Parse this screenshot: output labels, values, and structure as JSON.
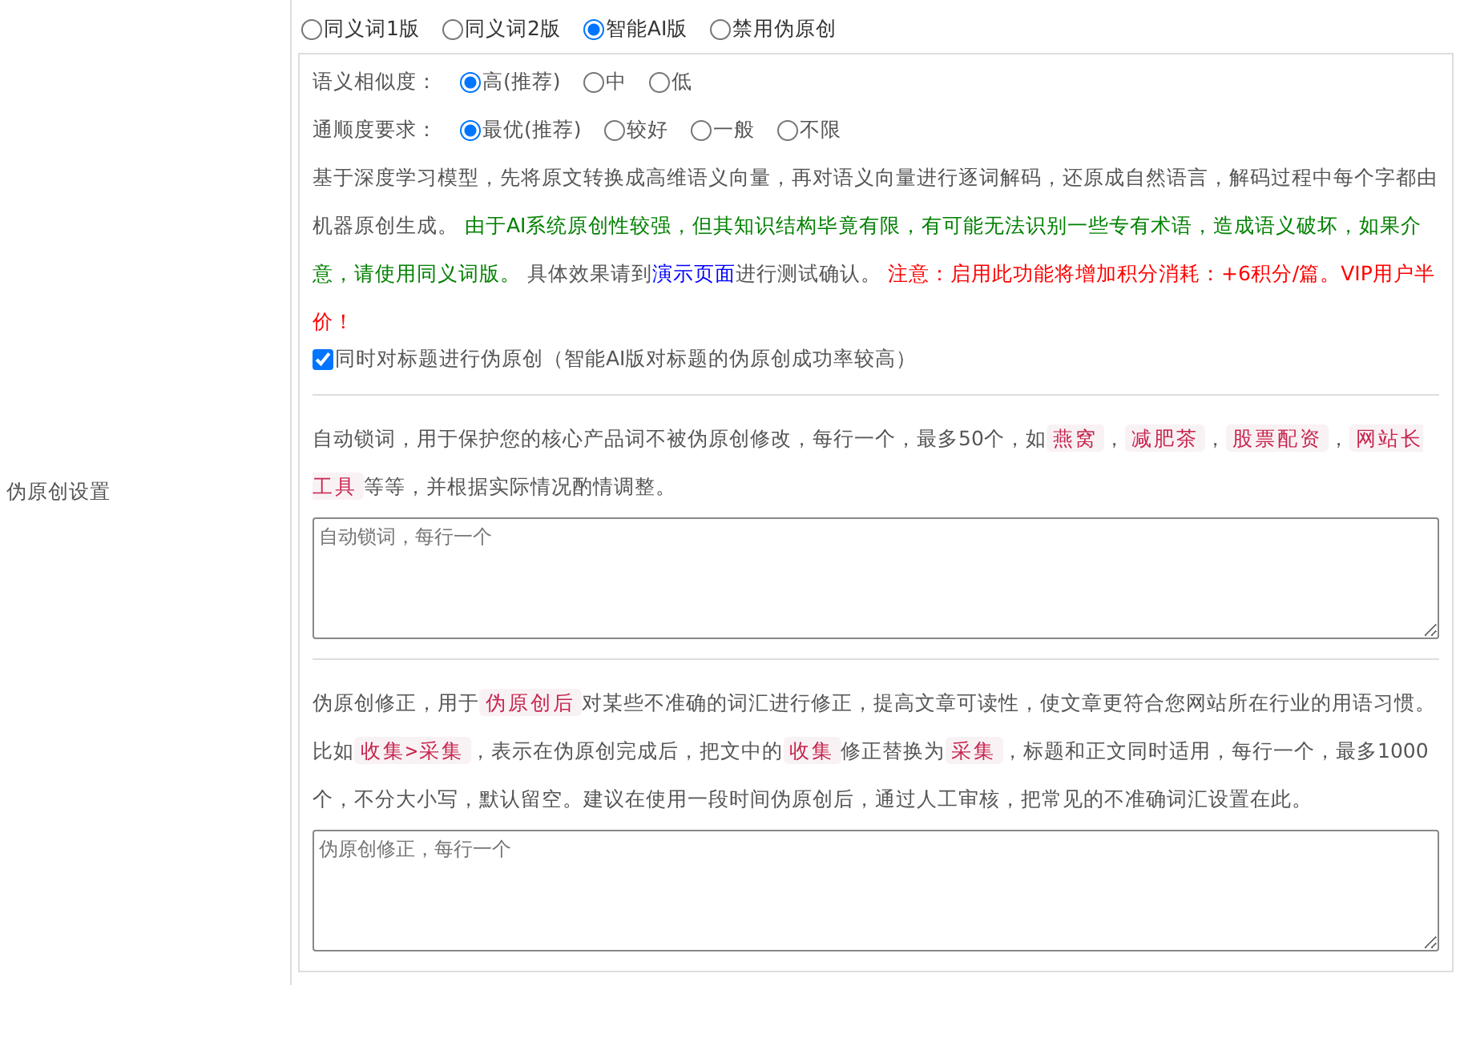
{
  "side_label": "伪原创设置",
  "modes": [
    {
      "label": "同义词1版",
      "selected": false
    },
    {
      "label": "同义词2版",
      "selected": false
    },
    {
      "label": "智能AI版",
      "selected": true
    },
    {
      "label": "禁用伪原创",
      "selected": false
    }
  ],
  "ai_options": {
    "similarity": {
      "label": "语义相似度：",
      "options": [
        {
          "label": "高(推荐)",
          "selected": true
        },
        {
          "label": "中",
          "selected": false
        },
        {
          "label": "低",
          "selected": false
        }
      ]
    },
    "fluency": {
      "label": "通顺度要求：",
      "options": [
        {
          "label": "最优(推荐)",
          "selected": true
        },
        {
          "label": "较好",
          "selected": false
        },
        {
          "label": "一般",
          "selected": false
        },
        {
          "label": "不限",
          "selected": false
        }
      ]
    },
    "description": [
      {
        "kind": "text",
        "text": "基于深度学习模型，先将原文转换成高维语义向量，再对语义向量进行逐词解码，还原成自然语言，解码过程中每个字都由机器原创生成。 "
      },
      {
        "kind": "notice",
        "text": "由于AI系统原创性较强，但其知识结构毕竟有限，有可能无法识别一些专有术语，造成语义破坏，如果介意，请使用同义词版。"
      },
      {
        "kind": "text",
        "text": " 具体效果请到"
      },
      {
        "kind": "link",
        "text": "演示页面"
      },
      {
        "kind": "text",
        "text": "进行测试确认。 "
      },
      {
        "kind": "warning",
        "text": "注意：启用此功能将增加积分消耗：+6积分/篇。VIP用户半价！"
      }
    ],
    "title_option": {
      "label": "同时对标题进行伪原创（智能AI版对标题的伪原创成功率较高）",
      "checked": true
    }
  },
  "lock_words": {
    "description": [
      {
        "kind": "text",
        "text": "自动锁词，用于保护您的核心产品词不被伪原创修改，每行一个，最多50个，如"
      },
      {
        "kind": "tag",
        "text": "燕窝"
      },
      {
        "kind": "text",
        "text": "，"
      },
      {
        "kind": "tag",
        "text": "减肥茶"
      },
      {
        "kind": "text",
        "text": "，"
      },
      {
        "kind": "tag",
        "text": "股票配资"
      },
      {
        "kind": "text",
        "text": "，"
      },
      {
        "kind": "tag",
        "text": "网站长工具"
      },
      {
        "kind": "text",
        "text": "等等，并根据实际情况酌情调整。"
      }
    ],
    "placeholder": "自动锁词，每行一个"
  },
  "corrections": {
    "description": [
      {
        "kind": "text",
        "text": "伪原创修正，用于"
      },
      {
        "kind": "tag",
        "text": "伪原创后"
      },
      {
        "kind": "text",
        "text": "对某些不准确的词汇进行修正，提高文章可读性，使文章更符合您网站所在行业的用语习惯。比如"
      },
      {
        "kind": "tag",
        "text": "收集>采集"
      },
      {
        "kind": "text",
        "text": "，表示在伪原创完成后，把文中的"
      },
      {
        "kind": "tag",
        "text": "收集"
      },
      {
        "kind": "text",
        "text": "修正替换为"
      },
      {
        "kind": "tag",
        "text": "采集"
      },
      {
        "kind": "text",
        "text": "，标题和正文同时适用，每行一个，最多1000个，不分大小写，默认留空。建议在使用一段时间伪原创后，通过人工审核，把常见的不准确词汇设置在此。"
      }
    ],
    "placeholder": "伪原创修正，每行一个"
  }
}
